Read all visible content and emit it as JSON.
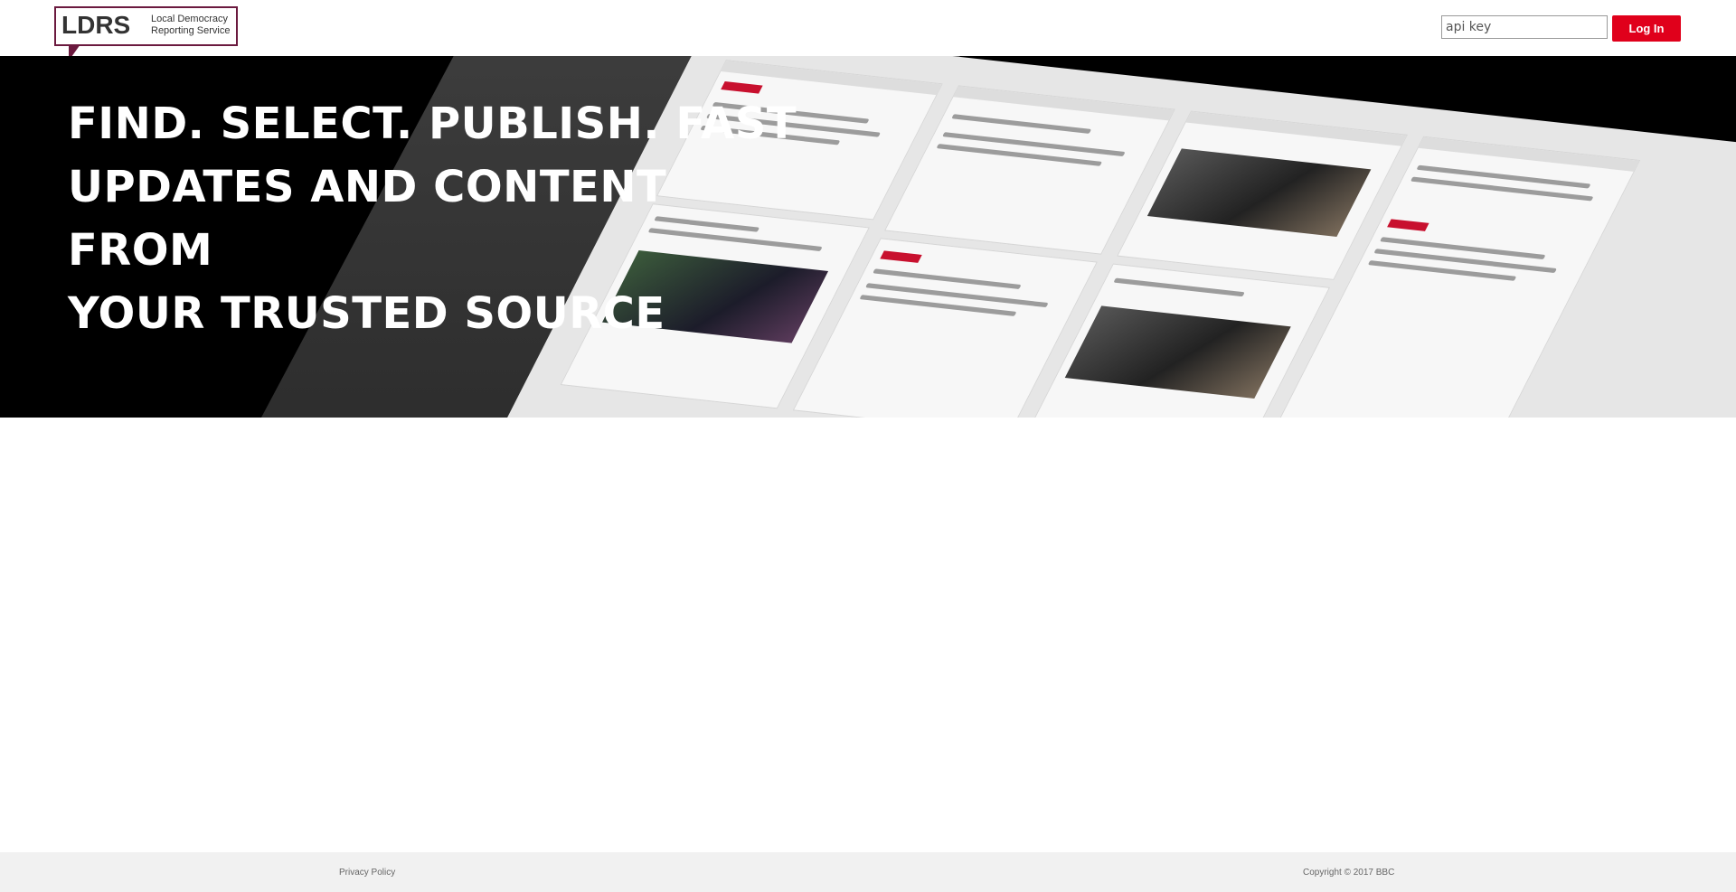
{
  "logo": {
    "mark": "LDRS",
    "tagline_line1": "Local Democracy",
    "tagline_line2": "Reporting Service"
  },
  "login": {
    "api_key_placeholder": "api key",
    "button_label": "Log In"
  },
  "hero": {
    "line1": "FIND. SELECT. PUBLISH. FAST",
    "line2": "UPDATES AND CONTENT FROM",
    "line3": "YOUR TRUSTED SOURCE"
  },
  "footer": {
    "privacy_label": "Privacy Policy",
    "copyright": "Copyright © 2017 BBC"
  },
  "colors": {
    "brand": "#6b1a3f",
    "accent": "#e0001b",
    "hero_bg": "#000000",
    "footer_bg": "#f1f1f1"
  }
}
